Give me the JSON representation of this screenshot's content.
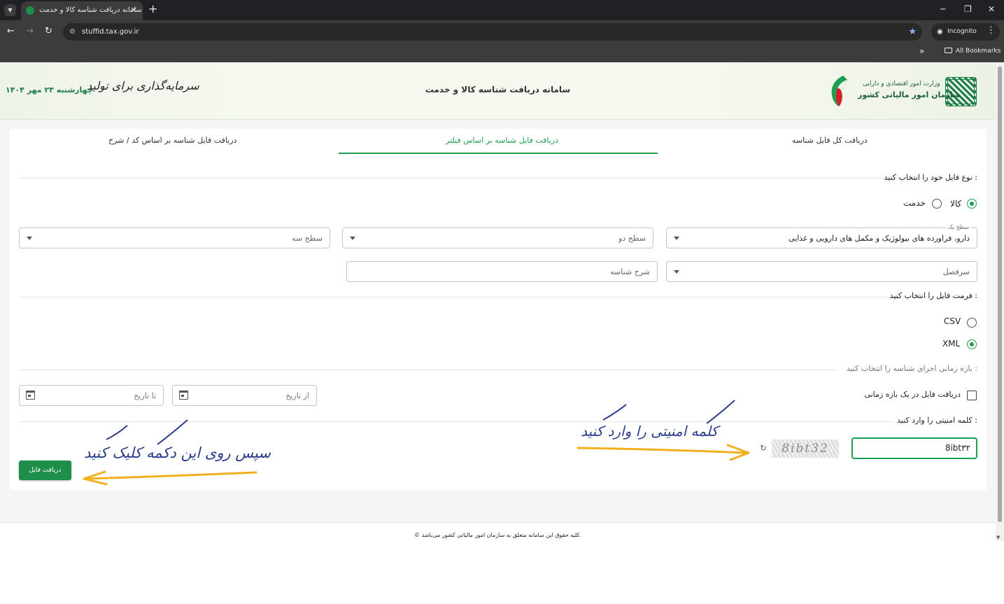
{
  "browser": {
    "tab_title": "سامانه دریافت شناسه کالا و خدمت",
    "url": "stuffid.tax.gov.ir",
    "profile": "Incognito",
    "bookmarks_label": "All Bookmarks"
  },
  "header": {
    "org_line1": "وزارت امور اقتصادی و دارایی",
    "org_line2": "سازمان امور مالیاتی کشور",
    "site_title": "سامانه دریافت شناسه کالا و خدمت",
    "slogan": "سرمایه‌گذاری برای تولید",
    "date": "چهارشنبه ۲۳ مهر ۱۴۰۴"
  },
  "tabs": [
    {
      "label": "دریافت کل فایل شناسه"
    },
    {
      "label": "دریافت فایل شناسه بر اساس فیلتر"
    },
    {
      "label": "دریافت فایل شناسه بر اساس کد / شرح"
    }
  ],
  "file_type": {
    "label": "نوع فایل خود را انتخاب کنید :",
    "options": [
      "کالا",
      "خدمت"
    ],
    "selected": "کالا"
  },
  "filters": {
    "level1_legend": "سطح یک",
    "level1_value": "دارو، فراورده های بیولوژیک و مکمل های دارویی و غذایی",
    "level2_placeholder": "سطح دو",
    "level3_placeholder": "سطح سه",
    "heading_placeholder": "سرفصل",
    "description_placeholder": "شرح شناسه"
  },
  "format": {
    "label": "فرمت فایل را انتخاب کنید :",
    "options": [
      "CSV",
      "XML"
    ],
    "selected": "XML"
  },
  "time_range": {
    "label": "بازه زمانی اجرای شناسه را انتخاب کنید :",
    "checkbox_label": "دریافت فایل در یک بازه زمانی",
    "from_placeholder": "از تاریخ",
    "to_placeholder": "تا تاریخ"
  },
  "captcha": {
    "label": "کلمه امنیتی را وارد کنید :",
    "input_value": "8ibt۳۲",
    "image_text": "8ibt32"
  },
  "submit_label": "دریافت فایل",
  "annotations": {
    "captcha_hint": "کلمه امنیتی را وارد کنید",
    "button_hint": "سپس روی این دکمه کلیک کنید"
  },
  "footer": "© کلیه حقوق این سامانه متعلق به سازمان امور مالیاتی کشور می‌باشد.",
  "colors": {
    "accent": "#1e9e50",
    "button": "#1e8f4a",
    "annotation_text": "#2a3c8c",
    "annotation_arrow": "#f2b01e"
  }
}
